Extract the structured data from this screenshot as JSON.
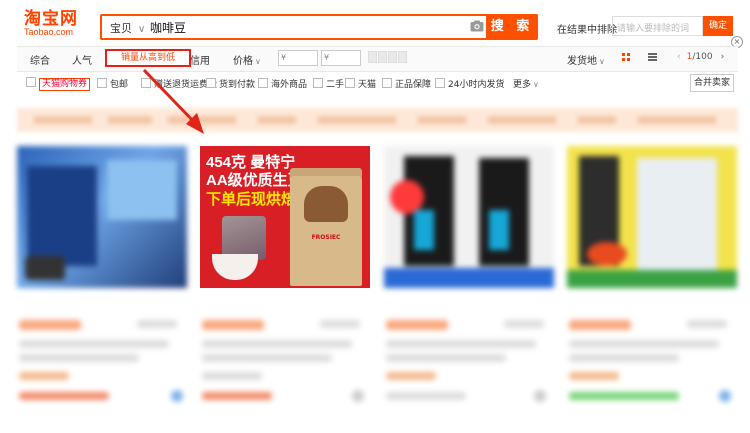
{
  "header": {
    "logo_cn": "淘宝网",
    "logo_en": "Taobao.com",
    "search_category": "宝贝",
    "search_query": "咖啡豆",
    "search_button": "搜 索",
    "exclude_label": "在结果中排除",
    "exclude_placeholder": "请输入要排除的词",
    "exclude_button": "确定"
  },
  "sortbar": {
    "items": [
      "综合",
      "人气",
      "销量从高到低",
      "信用",
      "价格"
    ],
    "price_from": "¥",
    "price_to": "¥",
    "ship_from": "发货地",
    "pager": {
      "current": "1",
      "total": "/100"
    }
  },
  "filters": {
    "tmall_label": "天猫购物券",
    "items": [
      "包邮",
      "赠送退货运费险",
      "货到付款",
      "海外商品",
      "二手",
      "天猫",
      "正品保障",
      "24小时内发货"
    ],
    "more": "更多",
    "merge": "合并卖家"
  },
  "featured": {
    "line1": "454克 曼特宁",
    "line2": "AA级优质生豆",
    "line3": "下单后现烘焙",
    "brand": "FROSIEC"
  },
  "colors": {
    "accent": "#ff5000",
    "highlight": "#e2231a"
  }
}
